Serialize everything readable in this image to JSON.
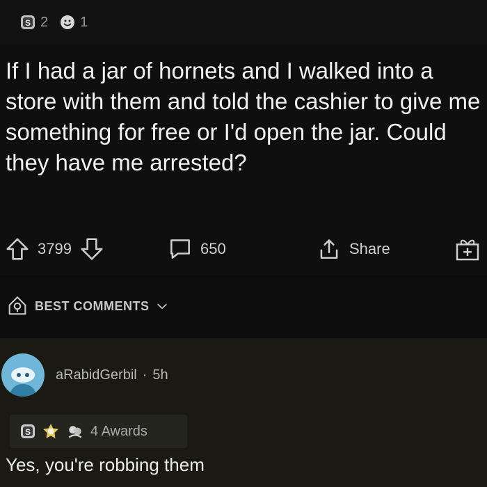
{
  "post": {
    "award_counts": {
      "silver": "2",
      "wholesome": "1"
    },
    "title": "If I had a jar of hornets and I walked into a store with them and told the cashier to give me something for free or I'd open the jar. Could they have me arrested?",
    "votes": "3799",
    "comments": "650",
    "share_label": "Share"
  },
  "sort": {
    "label": "BEST COMMENTS"
  },
  "comment": {
    "username": "aRabidGerbil",
    "separator": "·",
    "age": "5h",
    "awards_label": "4 Awards",
    "text": "Yes, you're robbing them"
  },
  "colors": {
    "background": "#0b0b0b",
    "comment_background": "#1a1a13",
    "avatar": "#6fb6d8",
    "text": "#f1f1f1",
    "muted": "#9a9a9a"
  },
  "icons": [
    "silver-award-icon",
    "wholesome-award-icon",
    "upvote-icon",
    "downvote-icon",
    "comment-icon",
    "share-icon",
    "add-award-icon",
    "sort-icon",
    "chevron-down-icon",
    "helpful-award-icon",
    "hugz-award-icon"
  ]
}
